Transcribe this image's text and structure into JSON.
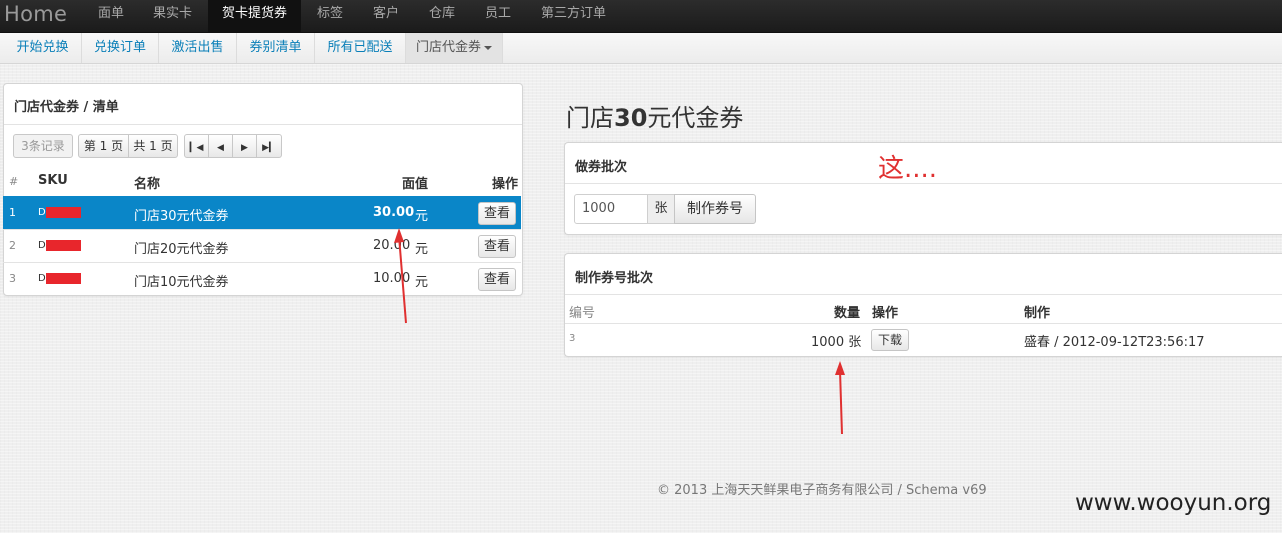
{
  "navbar": {
    "brand": "Home",
    "items": [
      "面单",
      "果实卡",
      "贺卡提货券",
      "标签",
      "客户",
      "仓库",
      "员工",
      "第三方订单"
    ],
    "active_index": 2
  },
  "subnav": {
    "items": [
      "开始兑换",
      "兑换订单",
      "激活出售",
      "券别清单",
      "所有已配送",
      "门店代金券"
    ],
    "active_index": 5
  },
  "list_panel": {
    "title": "门店代金券 / 清单",
    "pager": {
      "records": "3条记录",
      "page": "第 1 页",
      "total": "共 1 页"
    },
    "columns": [
      "#",
      "SKU",
      "名称",
      "面值",
      "操作"
    ],
    "rows": [
      {
        "index": "1",
        "sku_prefix": "D",
        "name": "门店30元代金券",
        "value": "30.00",
        "unit": "元",
        "action": "查看",
        "selected": true
      },
      {
        "index": "2",
        "sku_prefix": "D",
        "name": "门店20元代金券",
        "value": "20.00",
        "unit": "元",
        "action": "查看",
        "selected": false
      },
      {
        "index": "3",
        "sku_prefix": "D",
        "name": "门店10元代金券",
        "value": "10.00",
        "unit": "元",
        "action": "查看",
        "selected": false
      }
    ]
  },
  "page_title": {
    "prefix": "门店",
    "amount": "30",
    "suffix": "元代金券"
  },
  "batch_panel": {
    "title": "做券批次",
    "quantity_value": "1000",
    "unit": "张",
    "button": "制作券号"
  },
  "annotation_text": "这....",
  "made_panel": {
    "title": "制作券号批次",
    "columns": [
      "编号",
      "数量",
      "操作",
      "制作"
    ],
    "rows": [
      {
        "id": "3",
        "quantity": "1000 张",
        "action": "下载",
        "made_by": "盛春 / 2012-09-12T23:56:17"
      }
    ]
  },
  "footer": "© 2013 上海天天鲜果电子商务有限公司 / Schema v69",
  "watermark": "www.wooyun.org",
  "colors": {
    "navbar_bg": "#1b1b1b",
    "link": "#0a7fb8",
    "selected_row": "#0a86c8",
    "redaction": "#e8262c",
    "annotation": "#e03030"
  }
}
